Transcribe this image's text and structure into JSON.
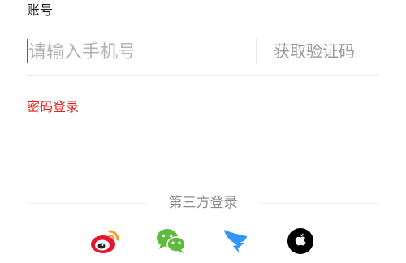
{
  "form": {
    "account_label": "账号",
    "phone_placeholder": "请输入手机号",
    "phone_value": "",
    "get_code_label": "获取验证码",
    "password_login_label": "密码登录"
  },
  "third_party": {
    "title": "第三方登录",
    "providers": [
      {
        "name": "weibo",
        "icon": "weibo-icon"
      },
      {
        "name": "wechat",
        "icon": "wechat-icon"
      },
      {
        "name": "dingtalk",
        "icon": "dingtalk-icon"
      },
      {
        "name": "apple",
        "icon": "apple-icon"
      }
    ]
  },
  "colors": {
    "accent_red": "#e02020",
    "placeholder_gray": "#b3b3b3",
    "wechat_green": "#5dbb3d",
    "weibo_red": "#e6162d",
    "dingtalk_blue": "#3296fa",
    "apple_black": "#000000"
  }
}
